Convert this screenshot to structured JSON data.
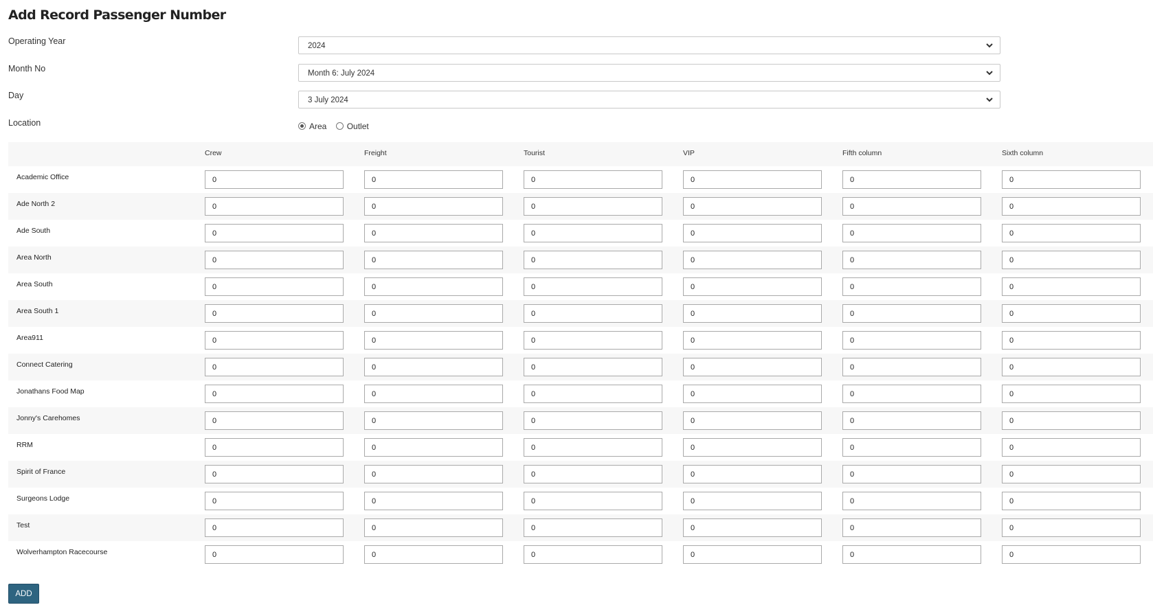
{
  "title": "Add Record Passenger Number",
  "filters": {
    "operating_year": {
      "label": "Operating Year",
      "value": "2024"
    },
    "month_no": {
      "label": "Month No",
      "value": "Month 6: July 2024"
    },
    "day": {
      "label": "Day",
      "value": "3 July 2024"
    },
    "location": {
      "label": "Location",
      "options": [
        "Area",
        "Outlet"
      ],
      "selected": "Area"
    }
  },
  "columns": [
    "Crew",
    "Freight",
    "Tourist",
    "VIP",
    "Fifth column",
    "Sixth column"
  ],
  "rows": [
    {
      "name": "Academic Office",
      "values": [
        "0",
        "0",
        "0",
        "0",
        "0",
        "0"
      ]
    },
    {
      "name": "Ade North 2",
      "values": [
        "0",
        "0",
        "0",
        "0",
        "0",
        "0"
      ]
    },
    {
      "name": "Ade South",
      "values": [
        "0",
        "0",
        "0",
        "0",
        "0",
        "0"
      ]
    },
    {
      "name": "Area North",
      "values": [
        "0",
        "0",
        "0",
        "0",
        "0",
        "0"
      ]
    },
    {
      "name": "Area South",
      "values": [
        "0",
        "0",
        "0",
        "0",
        "0",
        "0"
      ]
    },
    {
      "name": "Area South 1",
      "values": [
        "0",
        "0",
        "0",
        "0",
        "0",
        "0"
      ]
    },
    {
      "name": "Area911",
      "values": [
        "0",
        "0",
        "0",
        "0",
        "0",
        "0"
      ]
    },
    {
      "name": "Connect Catering",
      "values": [
        "0",
        "0",
        "0",
        "0",
        "0",
        "0"
      ]
    },
    {
      "name": "Jonathans Food Map",
      "values": [
        "0",
        "0",
        "0",
        "0",
        "0",
        "0"
      ]
    },
    {
      "name": "Jonny's Carehomes",
      "values": [
        "0",
        "0",
        "0",
        "0",
        "0",
        "0"
      ]
    },
    {
      "name": "RRM",
      "values": [
        "0",
        "0",
        "0",
        "0",
        "0",
        "0"
      ]
    },
    {
      "name": "Spirit of France",
      "values": [
        "0",
        "0",
        "0",
        "0",
        "0",
        "0"
      ]
    },
    {
      "name": "Surgeons Lodge",
      "values": [
        "0",
        "0",
        "0",
        "0",
        "0",
        "0"
      ]
    },
    {
      "name": "Test",
      "values": [
        "0",
        "0",
        "0",
        "0",
        "0",
        "0"
      ]
    },
    {
      "name": "Wolverhampton Racecourse",
      "values": [
        "0",
        "0",
        "0",
        "0",
        "0",
        "0"
      ]
    }
  ],
  "add_button": "ADD",
  "icons": {
    "select_arrow": "chevron-down-icon"
  },
  "colors": {
    "button": "#2e6480",
    "row_alt": "#f7f7f7"
  }
}
